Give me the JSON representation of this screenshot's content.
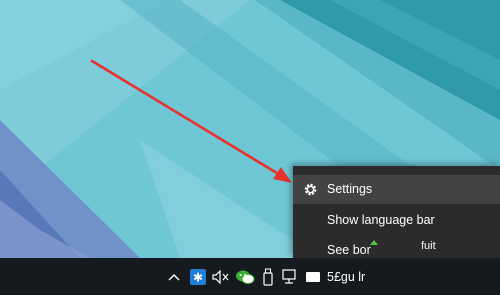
{
  "context_menu": {
    "items": [
      {
        "label": "Settings",
        "icon": "gear-icon"
      },
      {
        "label": "Show language bar"
      },
      {
        "label": "See bor"
      }
    ],
    "extra_text": "fuit"
  },
  "taskbar": {
    "tray_text": "5£gu lr",
    "icons": [
      "chevron-up-icon",
      "bluetooth-icon",
      "volume-muted-icon",
      "wechat-icon",
      "usb-drive-icon",
      "network-icon",
      "input-method-icon"
    ]
  },
  "colors": {
    "menu_background": "#2b2b2b",
    "menu_hover": "#434343",
    "taskbar_background": "#141a1d",
    "annotation_arrow": "#e8322d",
    "wechat_green": "#3cb034"
  }
}
